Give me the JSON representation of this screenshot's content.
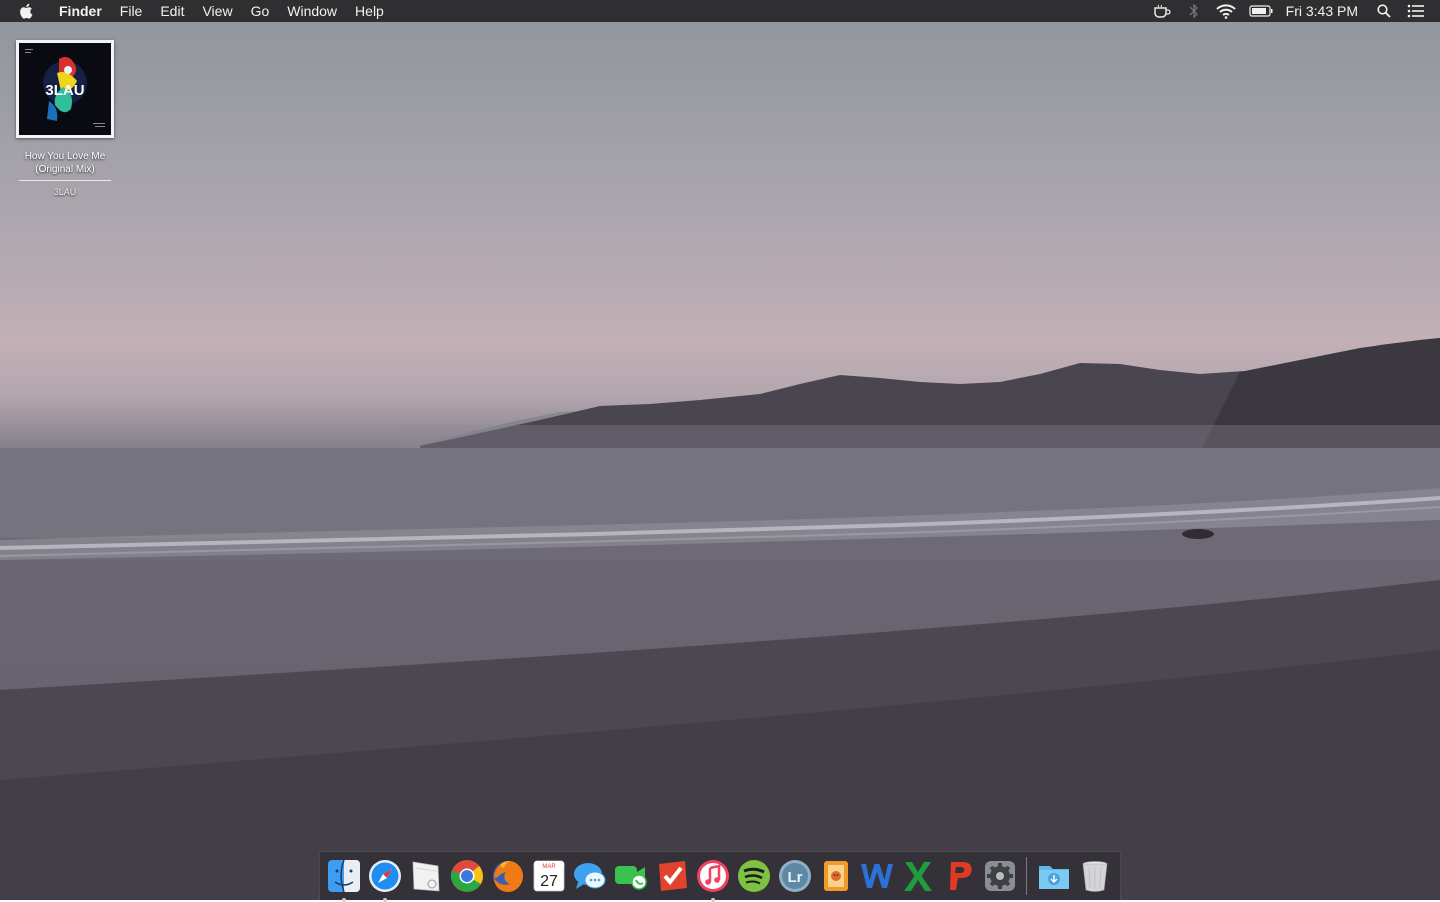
{
  "menubar": {
    "app_name": "Finder",
    "menus": [
      "File",
      "Edit",
      "View",
      "Go",
      "Window",
      "Help"
    ],
    "status_icons": [
      "coffee-cup-icon",
      "bluetooth-icon",
      "wifi-icon",
      "battery-icon"
    ],
    "clock": "Fri 3:43 PM"
  },
  "desktop": {
    "file": {
      "name": "How You Love Me (Original Mix)",
      "artist": "3LAU",
      "artwork_text": "3LAU"
    }
  },
  "dock": {
    "apps": [
      {
        "name": "finder",
        "icon": "finder-icon",
        "running": true
      },
      {
        "name": "safari",
        "icon": "safari-icon",
        "running": true
      },
      {
        "name": "mail",
        "icon": "mail-icon",
        "running": false
      },
      {
        "name": "chrome",
        "icon": "chrome-icon",
        "running": false
      },
      {
        "name": "firefox",
        "icon": "firefox-icon",
        "running": false
      },
      {
        "name": "calendar",
        "icon": "calendar-icon",
        "running": false,
        "month": "MAR",
        "day": "27"
      },
      {
        "name": "messages",
        "icon": "messages-icon",
        "running": false
      },
      {
        "name": "facetime",
        "icon": "facetime-icon",
        "running": false
      },
      {
        "name": "todoist",
        "icon": "todoist-icon",
        "running": false
      },
      {
        "name": "itunes",
        "icon": "itunes-icon",
        "running": true
      },
      {
        "name": "spotify",
        "icon": "spotify-icon",
        "running": false
      },
      {
        "name": "lightroom",
        "icon": "lightroom-icon",
        "running": false
      },
      {
        "name": "photo-booth",
        "icon": "photo-booth-icon",
        "running": false
      },
      {
        "name": "word",
        "icon": "word-icon",
        "running": false
      },
      {
        "name": "excel",
        "icon": "excel-icon",
        "running": false
      },
      {
        "name": "powerpoint",
        "icon": "powerpoint-icon",
        "running": false
      },
      {
        "name": "system-preferences",
        "icon": "gear-icon",
        "running": false
      }
    ],
    "folders": [
      {
        "name": "downloads",
        "icon": "downloads-folder-icon"
      },
      {
        "name": "trash",
        "icon": "trash-icon"
      }
    ]
  }
}
